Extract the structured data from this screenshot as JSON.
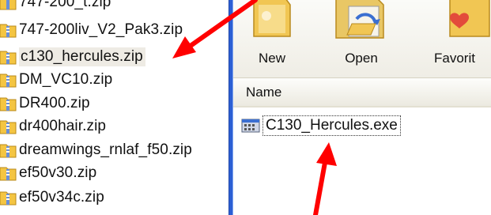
{
  "file_list": {
    "items": [
      {
        "label": "747-200_t.zip",
        "selected": false
      },
      {
        "label": "747-200liv_V2_Pak3.zip",
        "selected": false
      },
      {
        "label": "c130_hercules.zip",
        "selected": true
      },
      {
        "label": "DM_VC10.zip",
        "selected": false
      },
      {
        "label": "DR400.zip",
        "selected": false
      },
      {
        "label": "dr400hair.zip",
        "selected": false
      },
      {
        "label": "dreamwings_rnlaf_f50.zip",
        "selected": false
      },
      {
        "label": "ef50v30.zip",
        "selected": false
      },
      {
        "label": "ef50v34c.zip",
        "selected": false
      }
    ]
  },
  "toolbar": {
    "new_label": "New",
    "open_label": "Open",
    "favorites_label": "Favorit"
  },
  "content": {
    "column_header": "Name",
    "files": [
      {
        "label": "C130_Hercules.exe"
      }
    ]
  },
  "colors": {
    "divider": "#2c5fd4",
    "annotation_arrow": "#ff0000",
    "selection": "#eeebe4"
  },
  "icons": {
    "archive": "zip-folder-icon",
    "exe": "exe-file-icon",
    "new": "new-folder-icon",
    "open": "open-folder-icon",
    "favorites": "favorites-icon"
  }
}
